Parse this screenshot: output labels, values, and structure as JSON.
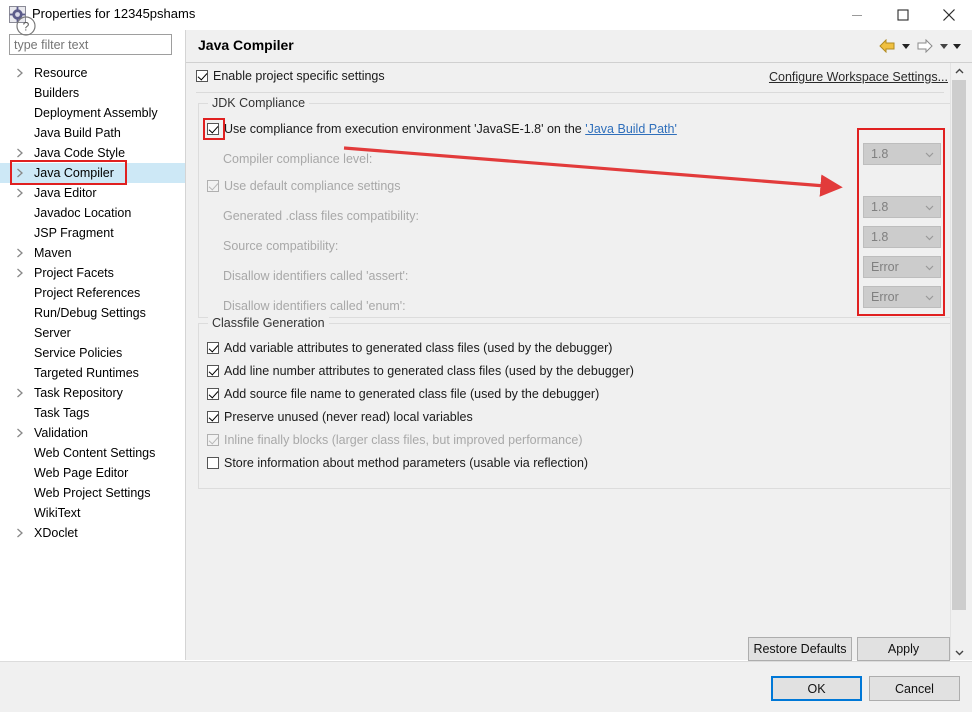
{
  "window": {
    "title": "Properties for 12345pshams",
    "icon": "eclipse-properties-icon",
    "minimize_label": "—",
    "maximize_label": "☐",
    "close_label": "✕"
  },
  "sidebar": {
    "filter_placeholder": "type filter text",
    "filter_value": "",
    "items": [
      {
        "label": "Resource",
        "expandable": true,
        "selected": false
      },
      {
        "label": "Builders",
        "expandable": false,
        "selected": false
      },
      {
        "label": "Deployment Assembly",
        "expandable": false,
        "selected": false
      },
      {
        "label": "Java Build Path",
        "expandable": false,
        "selected": false
      },
      {
        "label": "Java Code Style",
        "expandable": true,
        "selected": false
      },
      {
        "label": "Java Compiler",
        "expandable": true,
        "selected": true
      },
      {
        "label": "Java Editor",
        "expandable": true,
        "selected": false
      },
      {
        "label": "Javadoc Location",
        "expandable": false,
        "selected": false
      },
      {
        "label": "JSP Fragment",
        "expandable": false,
        "selected": false
      },
      {
        "label": "Maven",
        "expandable": true,
        "selected": false
      },
      {
        "label": "Project Facets",
        "expandable": true,
        "selected": false
      },
      {
        "label": "Project References",
        "expandable": false,
        "selected": false
      },
      {
        "label": "Run/Debug Settings",
        "expandable": false,
        "selected": false
      },
      {
        "label": "Server",
        "expandable": false,
        "selected": false
      },
      {
        "label": "Service Policies",
        "expandable": false,
        "selected": false
      },
      {
        "label": "Targeted Runtimes",
        "expandable": false,
        "selected": false
      },
      {
        "label": "Task Repository",
        "expandable": true,
        "selected": false
      },
      {
        "label": "Task Tags",
        "expandable": false,
        "selected": false
      },
      {
        "label": "Validation",
        "expandable": true,
        "selected": false
      },
      {
        "label": "Web Content Settings",
        "expandable": false,
        "selected": false
      },
      {
        "label": "Web Page Editor",
        "expandable": false,
        "selected": false
      },
      {
        "label": "Web Project Settings",
        "expandable": false,
        "selected": false
      },
      {
        "label": "WikiText",
        "expandable": false,
        "selected": false
      },
      {
        "label": "XDoclet",
        "expandable": true,
        "selected": false
      }
    ]
  },
  "page": {
    "title": "Java Compiler",
    "nav": {
      "back_icon": "back-arrow-icon",
      "back_menu_icon": "chevron-down-icon",
      "forward_icon": "forward-arrow-icon",
      "forward_menu_icon": "chevron-down-icon",
      "overflow_icon": "chevron-down-icon"
    },
    "enable_project_specific": {
      "label": "Enable project specific settings",
      "checked": true
    },
    "configure_workspace_link": "Configure Workspace Settings...",
    "collapse_icon": "chevron-up-icon"
  },
  "jdk_compliance": {
    "group_title": "JDK Compliance",
    "use_execution_env": {
      "label_prefix": "Use compliance from execution environment 'JavaSE-1.8' on the ",
      "link": "'Java Build Path'",
      "checked": true,
      "enabled": true
    },
    "fields": [
      {
        "label": "Compiler compliance level:",
        "value": "1.8",
        "type": "combo",
        "enabled": false,
        "checkbox": false
      },
      {
        "label": "Use default compliance settings",
        "value": "",
        "type": "checkbox",
        "enabled": false,
        "checked": true
      },
      {
        "label": "Generated .class files compatibility:",
        "value": "1.8",
        "type": "combo",
        "enabled": false,
        "checkbox": false
      },
      {
        "label": "Source compatibility:",
        "value": "1.8",
        "type": "combo",
        "enabled": false,
        "checkbox": false
      },
      {
        "label": "Disallow identifiers called 'assert':",
        "value": "Error",
        "type": "combo",
        "enabled": false,
        "checkbox": false
      },
      {
        "label": "Disallow identifiers called 'enum':",
        "value": "Error",
        "type": "combo",
        "enabled": false,
        "checkbox": false
      }
    ],
    "combo_arrow_icon": "chevron-down-icon"
  },
  "classfile_generation": {
    "group_title": "Classfile Generation",
    "options": [
      {
        "label": "Add variable attributes to generated class files (used by the debugger)",
        "checked": true,
        "enabled": true
      },
      {
        "label": "Add line number attributes to generated class files (used by the debugger)",
        "checked": true,
        "enabled": true
      },
      {
        "label": "Add source file name to generated class file (used by the debugger)",
        "checked": true,
        "enabled": true
      },
      {
        "label": "Preserve unused (never read) local variables",
        "checked": true,
        "enabled": true
      },
      {
        "label": "Inline finally blocks (larger class files, but improved performance)",
        "checked": true,
        "enabled": false
      },
      {
        "label": "Store information about method parameters (usable via reflection)",
        "checked": false,
        "enabled": true
      }
    ]
  },
  "footer": {
    "restore_defaults": "Restore Defaults",
    "apply": "Apply",
    "ok": "OK",
    "cancel": "Cancel",
    "help_icon": "help-question-icon"
  },
  "scrollbar": {
    "up_icon": "chevron-up-icon",
    "down_icon": "chevron-down-icon"
  },
  "annotations": {
    "accent_color": "#e02020",
    "highlight_tree_item": "Java Compiler",
    "highlight_checkbox": "use-execution-environment-checkbox",
    "highlight_combos": "compliance-combo-group",
    "arrow": "red-arrow-pointing-to-combos"
  },
  "colors": {
    "dialog_bg": "#f0f0f0",
    "panel_bg": "#ffffff",
    "selection_bg": "#cde8f6",
    "link": "#2f6fbb",
    "focus_border": "#0078d7",
    "combo_disabled_bg": "#cccccc"
  }
}
